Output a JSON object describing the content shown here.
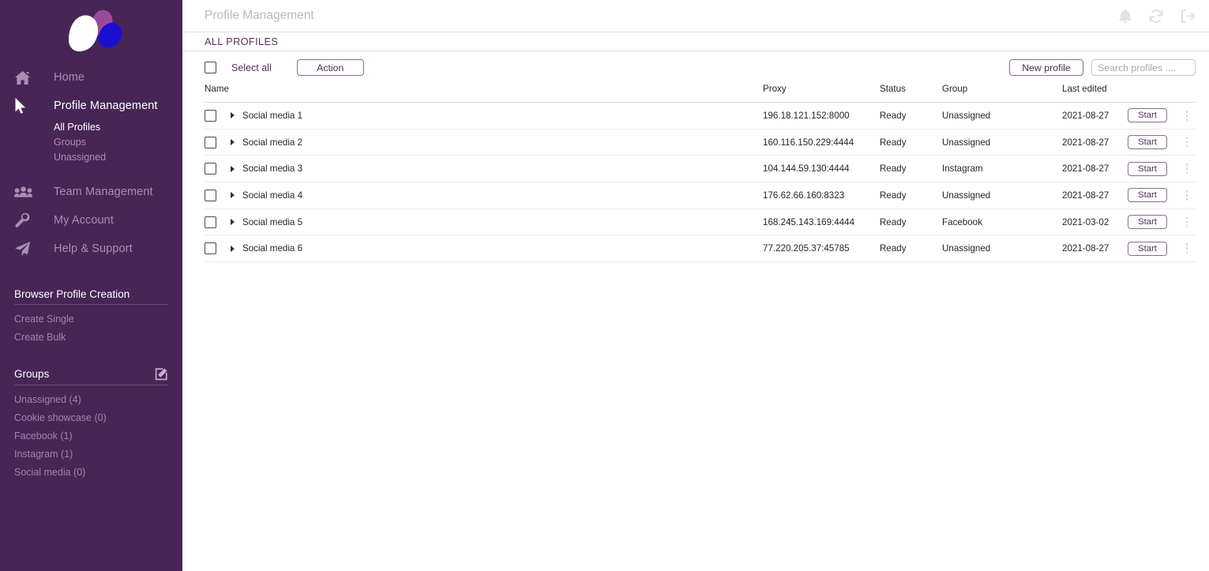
{
  "brand": {
    "logo_name": "butterfly-logo",
    "sidebar_bg": "#472655",
    "accent_purple": "#5c2c63",
    "logo_petal_white": "#ffffff",
    "logo_petal_purple": "#9b4a9b",
    "logo_petal_blue": "#1a0fd0"
  },
  "sidebar": {
    "nav": [
      {
        "label": "Home",
        "icon": "home-icon",
        "active": false
      },
      {
        "label": "Profile Management",
        "icon": "cursor-icon",
        "active": true
      },
      {
        "label": "Team Management",
        "icon": "team-icon",
        "active": false
      },
      {
        "label": "My Account",
        "icon": "wrench-icon",
        "active": false
      },
      {
        "label": "Help & Support",
        "icon": "paper-plane-icon",
        "active": false
      }
    ],
    "subnav": [
      {
        "label": "All Profiles",
        "active": true
      },
      {
        "label": "Groups",
        "active": false
      },
      {
        "label": "Unassigned",
        "active": false
      }
    ],
    "creation": {
      "heading": "Browser Profile Creation",
      "links": [
        {
          "label": "Create Single"
        },
        {
          "label": "Create Bulk"
        }
      ]
    },
    "groups": {
      "heading": "Groups",
      "edit_icon": "edit-square-icon",
      "items": [
        {
          "label": "Unassigned (4)"
        },
        {
          "label": "Cookie showcase (0)"
        },
        {
          "label": "Facebook (1)"
        },
        {
          "label": "Instagram (1)"
        },
        {
          "label": "Social media (0)"
        }
      ]
    }
  },
  "header": {
    "title": "Profile Management",
    "icons": [
      {
        "name": "bell-icon"
      },
      {
        "name": "refresh-icon"
      },
      {
        "name": "logout-icon"
      }
    ]
  },
  "tabs": [
    {
      "label": "ALL PROFILES",
      "active": true
    }
  ],
  "toolbar": {
    "select_all_label": "Select all",
    "action_label": "Action",
    "new_profile_label": "New profile",
    "search_placeholder": "Search profiles ....",
    "search_value": ""
  },
  "table": {
    "columns": [
      "Name",
      "Proxy",
      "Status",
      "Group",
      "Last edited"
    ],
    "row_action_label": "Start",
    "rows": [
      {
        "name": "Social media 1",
        "proxy": "196.18.121.152:8000",
        "status": "Ready",
        "group": "Unassigned",
        "edited": "2021-08-27"
      },
      {
        "name": "Social media 2",
        "proxy": "160.116.150.229:4444",
        "status": "Ready",
        "group": "Unassigned",
        "edited": "2021-08-27"
      },
      {
        "name": "Social media 3",
        "proxy": "104.144.59.130:4444",
        "status": "Ready",
        "group": "Instagram",
        "edited": "2021-08-27"
      },
      {
        "name": "Social media 4",
        "proxy": "176.62.66.160:8323",
        "status": "Ready",
        "group": "Unassigned",
        "edited": "2021-08-27"
      },
      {
        "name": "Social media 5",
        "proxy": "168.245.143.169:4444",
        "status": "Ready",
        "group": "Facebook",
        "edited": "2021-03-02"
      },
      {
        "name": "Social media 6",
        "proxy": "77.220.205.37:45785",
        "status": "Ready",
        "group": "Unassigned",
        "edited": "2021-08-27"
      }
    ]
  }
}
